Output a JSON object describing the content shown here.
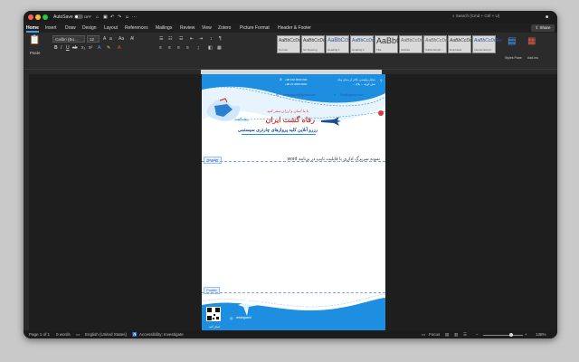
{
  "window": {
    "autosave_label": "AutoSave",
    "autosave_state": "OFF",
    "search_placeholder": "Search (Cmd + Ctrl + U)",
    "share_label": "Share"
  },
  "ribbon_tabs": [
    "Home",
    "Insert",
    "Draw",
    "Design",
    "Layout",
    "References",
    "Mailings",
    "Review",
    "View",
    "Zotero",
    "Picture Format",
    "Header & Footer"
  ],
  "active_tab": "Home",
  "ribbon": {
    "paste_label": "Paste",
    "font_name": "Calibri (Bo...",
    "font_size": "12",
    "styles": [
      {
        "sample": "AaBbCcDdEe",
        "name": "Normal"
      },
      {
        "sample": "AaBbCcDdEe",
        "name": "No Spacing"
      },
      {
        "sample": "AaBbCcI",
        "name": "Heading 1"
      },
      {
        "sample": "AaBbCcDd",
        "name": "Heading 2"
      },
      {
        "sample": "AaBbC",
        "name": "Title"
      },
      {
        "sample": "AaBbCcDdEe",
        "name": "Subtitle"
      },
      {
        "sample": "AaBbCcDdEe",
        "name": "Subtle Emph..."
      },
      {
        "sample": "AaBbCcDdEe",
        "name": "Emphasis"
      },
      {
        "sample": "AaBbCcDdEe",
        "name": "Intense Emph..."
      }
    ],
    "styles_pane_label": "Styles Pane",
    "addins_label": "Add-ins"
  },
  "document": {
    "header": {
      "address_line1": "خیابان ولیعصر، بالاتر از میدان ونک",
      "address_line2": "نبش کوچه ... پلاک ...",
      "phones": "+98 910 0000 000",
      "phones2": "+98 21 0000 0000",
      "email": "refahgasht@gmail.com",
      "website": "Refahgasht.com",
      "tagline": "با ما آسان و ارزان سفر کنید",
      "company_name": "رفاه گشت ایران",
      "subtitle": "رزرو آنلاین کلیه پروازهای چارتری سیستمی",
      "logo_text": "رفاه گشت"
    },
    "header_label": "Header",
    "body_text": "نمونه سربرگ اداری با قابلیت تایپ در برنامه word",
    "footer_label": "Footer",
    "footer": {
      "instagram": "refahgasht",
      "qr_caption": "اسکن کنید"
    }
  },
  "statusbar": {
    "page": "Page 1 of 1",
    "words": "0 words",
    "language": "English (United States)",
    "accessibility": "Accessibility: Investigate",
    "focus": "Focus",
    "zoom": "138%"
  },
  "colors": {
    "accent": "#4a9cf2",
    "brand_blue": "#1e8fe0",
    "brand_red": "#d63a3a"
  }
}
